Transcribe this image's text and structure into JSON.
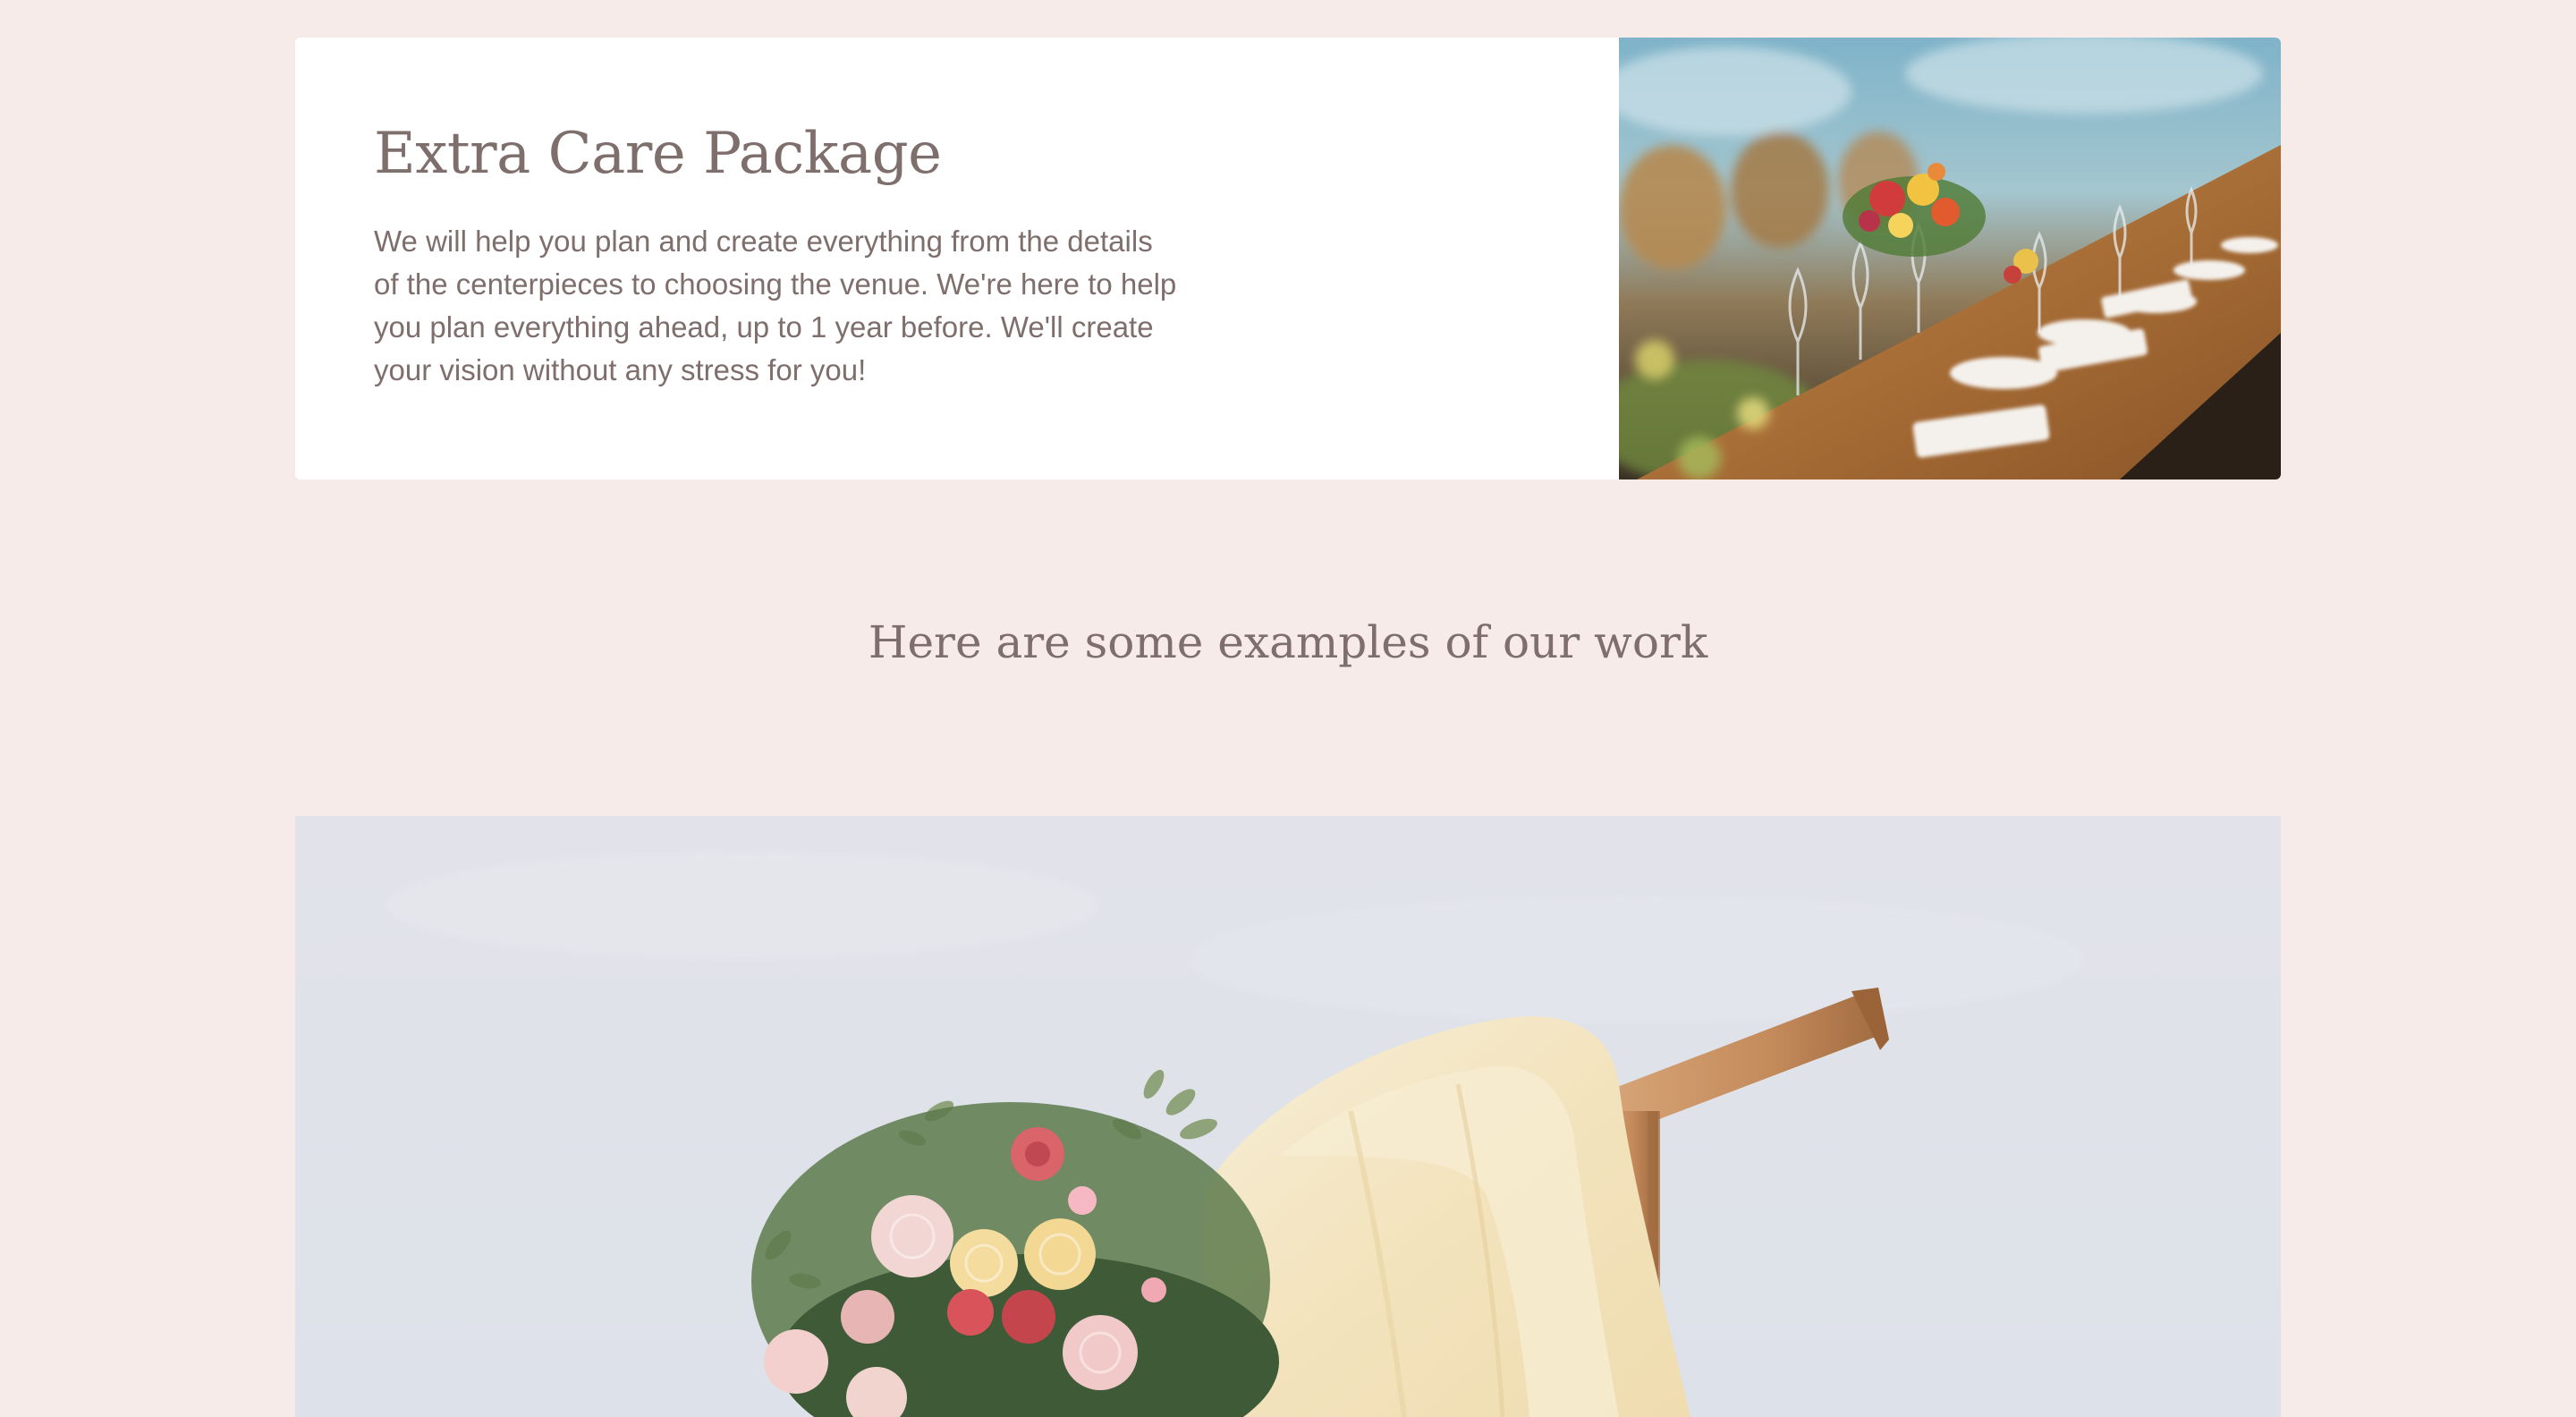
{
  "package": {
    "title": "Extra Care Package",
    "description": "We will help you plan and create everything from the details of the centerpieces to choosing the venue. We're here to help you plan everything ahead, up to 1 year before. We'll create your vision without any stress for you!",
    "photo_alt": "Long banquet table set with wine glasses, plates and floral centerpieces"
  },
  "examples": {
    "heading": "Here are some examples of our work",
    "photo_alt": "Wedding arch draped with cream fabric and a bouquet of roses against a pale sky"
  },
  "colors": {
    "page_background": "#f6ebe8",
    "card_background": "#ffffff",
    "text": "#7e6e6c"
  }
}
